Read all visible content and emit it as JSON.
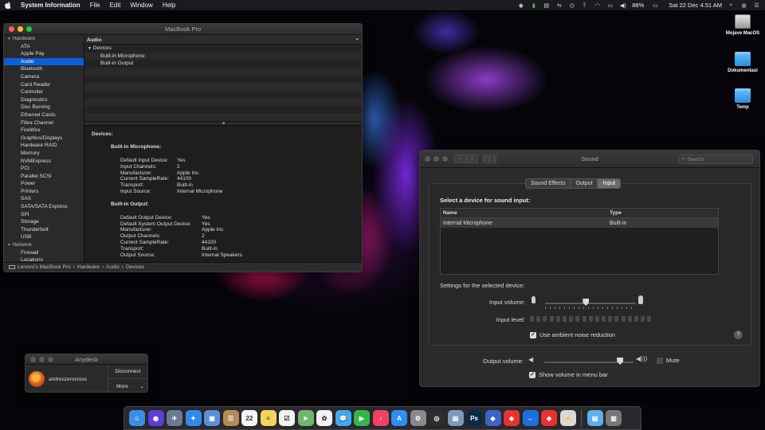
{
  "menubar": {
    "app_name": "System Information",
    "menus": [
      "File",
      "Edit",
      "Window",
      "Help"
    ],
    "battery": "88%",
    "datetime": "Sat 22 Dec  4.51 AM"
  },
  "desktop_icons": [
    {
      "label": "Mojave MacOS",
      "icon": "drive-icon"
    },
    {
      "label": "Dokumentasi",
      "icon": "folder-icon"
    },
    {
      "label": "Temp",
      "icon": "folder-icon"
    }
  ],
  "sysinfo": {
    "title": "MacBook Pro",
    "sidebar": {
      "hardware_label": "Hardware",
      "items": [
        "ATA",
        "Apple Pay",
        "Audio",
        "Bluetooth",
        "Camera",
        "Card Reader",
        "Controller",
        "Diagnostics",
        "Disc Burning",
        "Ethernet Cards",
        "Fibre Channel",
        "FireWire",
        "Graphics/Displays",
        "Hardware RAID",
        "Memory",
        "NVMExpress",
        "PCI",
        "Parallel SCSI",
        "Power",
        "Printers",
        "SAS",
        "SATA/SATA Express",
        "SPI",
        "Storage",
        "Thunderbolt",
        "USB"
      ],
      "selected": "Audio",
      "network_label": "Network",
      "network_items": [
        "Firewall",
        "Locations"
      ]
    },
    "list": {
      "header": "Audio",
      "group": "Devices",
      "children": [
        "Built-in Microphone",
        "Built-in Output"
      ]
    },
    "detail": {
      "heading": "Devices:",
      "mic_title": "Built-in Microphone:",
      "mic_props": [
        {
          "k": "Default Input Device:",
          "v": "Yes"
        },
        {
          "k": "Input Channels:",
          "v": "2"
        },
        {
          "k": "Manufacturer:",
          "v": "Apple Inc."
        },
        {
          "k": "Current SampleRate:",
          "v": "44100"
        },
        {
          "k": "Transport:",
          "v": "Built-in"
        },
        {
          "k": "Input Source:",
          "v": "Internal Microphone"
        }
      ],
      "out_title": "Built-in Output:",
      "out_props": [
        {
          "k": "Default Output Device:",
          "v": "Yes"
        },
        {
          "k": "Default System Output Device:",
          "v": "Yes"
        },
        {
          "k": "Manufacturer:",
          "v": "Apple Inc."
        },
        {
          "k": "Output Channels:",
          "v": "2"
        },
        {
          "k": "Current SampleRate:",
          "v": "44100"
        },
        {
          "k": "Transport:",
          "v": "Built-in"
        },
        {
          "k": "Output Source:",
          "v": "Internal Speakers"
        }
      ]
    },
    "path": [
      "Lenovo's MacBook Pro",
      "Hardware",
      "Audio",
      "Devices"
    ]
  },
  "sound": {
    "title": "Sound",
    "search_placeholder": "Search",
    "tabs": [
      "Sound Effects",
      "Output",
      "Input"
    ],
    "selected_tab": "Input",
    "prompt": "Select a device for sound input:",
    "columns": [
      "Name",
      "Type"
    ],
    "devices": [
      {
        "name": "Internal Microphone",
        "type": "Built-in"
      }
    ],
    "settings_label": "Settings for the selected device:",
    "input_volume_label": "Input volume:",
    "input_volume": 0.45,
    "input_level_label": "Input level:",
    "ambient_label": "Use ambient noise reduction",
    "ambient_checked": true,
    "output_volume_label": "Output volume:",
    "output_volume": 0.85,
    "mute_label": "Mute",
    "mute_checked": false,
    "show_volume_label": "Show volume in menu bar",
    "show_volume_checked": true
  },
  "anydesk": {
    "title": "Anydesk",
    "user": "andreszerocross",
    "disconnect": "Disconnect",
    "more": "More"
  },
  "dock": {
    "apps": [
      {
        "name": "finder",
        "color": "#3a8ee6",
        "label": "☺",
        "running": true
      },
      {
        "name": "siri",
        "color": "#5b3fd6",
        "label": "◉",
        "running": false
      },
      {
        "name": "launchpad",
        "color": "#6c7a91",
        "label": "✈",
        "running": false
      },
      {
        "name": "safari",
        "color": "#2f8cec",
        "label": "✦",
        "running": true
      },
      {
        "name": "preview",
        "color": "#5c8fd8",
        "label": "▣",
        "running": false
      },
      {
        "name": "contacts",
        "color": "#b98a55",
        "label": "☰",
        "running": false
      },
      {
        "name": "calendar",
        "color": "#f4f4f4",
        "label": "22",
        "running": false
      },
      {
        "name": "notes",
        "color": "#f3d35c",
        "label": "≡",
        "running": false
      },
      {
        "name": "reminders",
        "color": "#f2f2f2",
        "label": "☑",
        "running": false
      },
      {
        "name": "maps",
        "color": "#6fb86b",
        "label": "➤",
        "running": false
      },
      {
        "name": "photos",
        "color": "#f2f2f2",
        "label": "✿",
        "running": false
      },
      {
        "name": "messages",
        "color": "#3ea9f5",
        "label": "💬",
        "running": false
      },
      {
        "name": "facetime",
        "color": "#35b54a",
        "label": "▶",
        "running": false
      },
      {
        "name": "music",
        "color": "#f3425f",
        "label": "♪",
        "running": false
      },
      {
        "name": "app-store",
        "color": "#2d8ff2",
        "label": "A",
        "running": false
      },
      {
        "name": "system-preferences",
        "color": "#8a8a8a",
        "label": "⚙",
        "running": true
      },
      {
        "name": "activity-monitor",
        "color": "#2d2d2d",
        "label": "◎",
        "running": false
      },
      {
        "name": "image-viewer",
        "color": "#7a9abb",
        "label": "▤",
        "running": false
      },
      {
        "name": "photoshop",
        "color": "#0b2a44",
        "label": "Ps",
        "running": false
      },
      {
        "name": "stacks",
        "color": "#3f63c9",
        "label": "◆",
        "running": false
      },
      {
        "name": "anydesk",
        "color": "#e8322f",
        "label": "◆",
        "running": true
      },
      {
        "name": "teamviewer",
        "color": "#1d6fe0",
        "label": "↔",
        "running": false
      },
      {
        "name": "anydesk-2",
        "color": "#e8322f",
        "label": "◆",
        "running": false
      },
      {
        "name": "network-utility",
        "color": "#d8d8d8",
        "label": "⚡",
        "running": false
      }
    ],
    "trailing": [
      {
        "name": "downloads-stack",
        "color": "#5fb0e8",
        "label": "▤"
      },
      {
        "name": "trash",
        "color": "#777",
        "label": "▥"
      }
    ]
  }
}
